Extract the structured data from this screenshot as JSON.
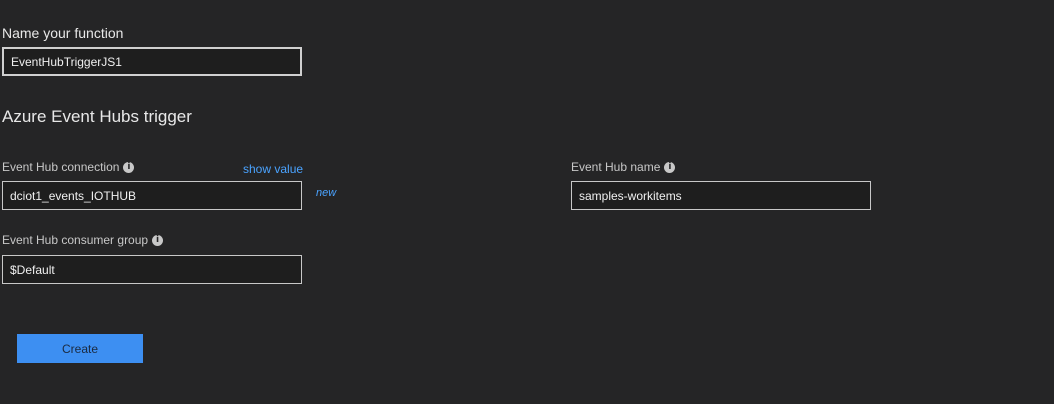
{
  "function_name": {
    "label": "Name your function",
    "value": "EventHubTriggerJS1"
  },
  "section_title": "Azure Event Hubs trigger",
  "event_hub_connection": {
    "label": "Event Hub connection",
    "show_value_link": "show value",
    "value": "dciot1_events_IOTHUB",
    "new_link": "new"
  },
  "event_hub_name": {
    "label": "Event Hub name",
    "value": "samples-workitems"
  },
  "consumer_group": {
    "label": "Event Hub consumer group",
    "value": "$Default"
  },
  "create_button": {
    "label": "Create"
  },
  "icons": {
    "info": "info-icon"
  },
  "colors": {
    "background": "#252526",
    "accent": "#3d8ff2",
    "link": "#4aa3ff"
  }
}
